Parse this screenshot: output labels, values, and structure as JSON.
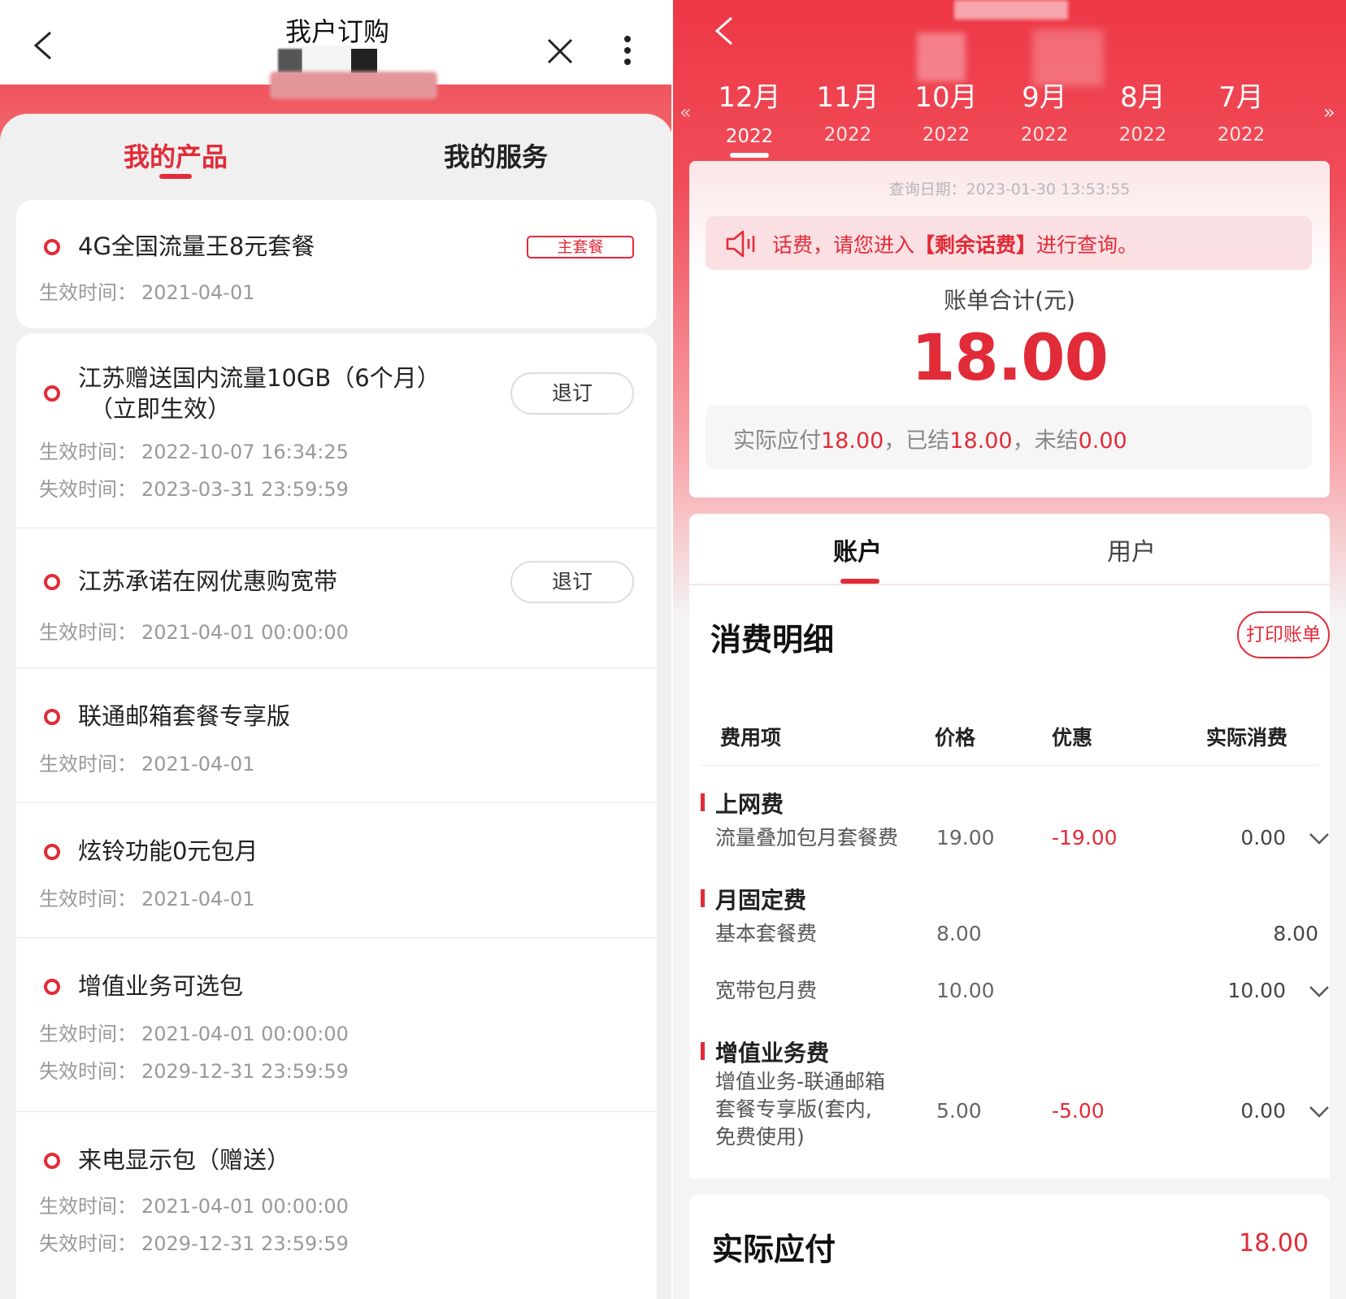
{
  "left": {
    "nav": {
      "title": "我户订购"
    },
    "tabs": [
      {
        "label": "我的产品"
      },
      {
        "label": "我的服务"
      }
    ],
    "meta_labels": {
      "effective": "生效时间：",
      "expire": "失效时间："
    },
    "products": [
      {
        "name": "4G全国流量王8元套餐",
        "badge": "主套餐",
        "effective": "2021-04-01"
      },
      {
        "name": "江苏赠送国内流量10GB（6个月）",
        "name2": "（立即生效）",
        "action": "退订",
        "effective": "2022-10-07 16:34:25",
        "expire": "2023-03-31 23:59:59"
      },
      {
        "name": "江苏承诺在网优惠购宽带",
        "action": "退订",
        "effective": "2021-04-01 00:00:00"
      },
      {
        "name": "联通邮箱套餐专享版",
        "effective": "2021-04-01"
      },
      {
        "name": "炫铃功能0元包月",
        "effective": "2021-04-01"
      },
      {
        "name": "增值业务可选包",
        "effective": "2021-04-01 00:00:00",
        "expire": "2029-12-31 23:59:59"
      },
      {
        "name": "来电显示包（赠送）",
        "effective": "2021-04-01 00:00:00",
        "expire": "2029-12-31 23:59:59"
      }
    ]
  },
  "right": {
    "months": [
      {
        "m": "12月",
        "y": "2022",
        "active": true
      },
      {
        "m": "11月",
        "y": "2022"
      },
      {
        "m": "10月",
        "y": "2022"
      },
      {
        "m": "9月",
        "y": "2022"
      },
      {
        "m": "8月",
        "y": "2022"
      },
      {
        "m": "7月",
        "y": "2022"
      }
    ],
    "query_date": "查询日期：2023-01-30 13:53:55",
    "notice": {
      "pre": "话费，请您进入",
      "bold": "【剩余话费】",
      "post": "进行查询。"
    },
    "total_label": "账单合计(元)",
    "total_value": "18.00",
    "summary": {
      "p1": "实际应付",
      "v1": "18.00",
      "p2": "，已结",
      "v2": "18.00",
      "p3": "，未结",
      "v3": "0.00"
    },
    "tabs": [
      {
        "label": "账户"
      },
      {
        "label": "用户"
      }
    ],
    "detail": {
      "title": "消费明细",
      "print_label": "打印账单",
      "headers": {
        "item": "费用项",
        "price": "价格",
        "discount": "优惠",
        "actual": "实际消费"
      },
      "groups": [
        {
          "name": "上网费",
          "rows": [
            {
              "item": "流量叠加包月套餐费",
              "price": "19.00",
              "discount": "-19.00",
              "actual": "0.00",
              "expand": true
            }
          ]
        },
        {
          "name": "月固定费",
          "rows": [
            {
              "item": "基本套餐费",
              "price": "8.00",
              "discount": "",
              "actual": "8.00",
              "expand": false
            },
            {
              "item": "宽带包月费",
              "price": "10.00",
              "discount": "",
              "actual": "10.00",
              "expand": true
            }
          ]
        },
        {
          "name": "增值业务费",
          "rows": [
            {
              "item": "增值业务-联通邮箱套餐专享版(套内,免费使用)",
              "item_lines": [
                "增值业务-联通邮箱",
                "套餐专享版(套内,",
                "免费使用)"
              ],
              "price": "5.00",
              "discount": "-5.00",
              "actual": "0.00",
              "expand": true
            }
          ]
        }
      ]
    },
    "pay": {
      "label": "实际应付",
      "value": "18.00"
    }
  }
}
